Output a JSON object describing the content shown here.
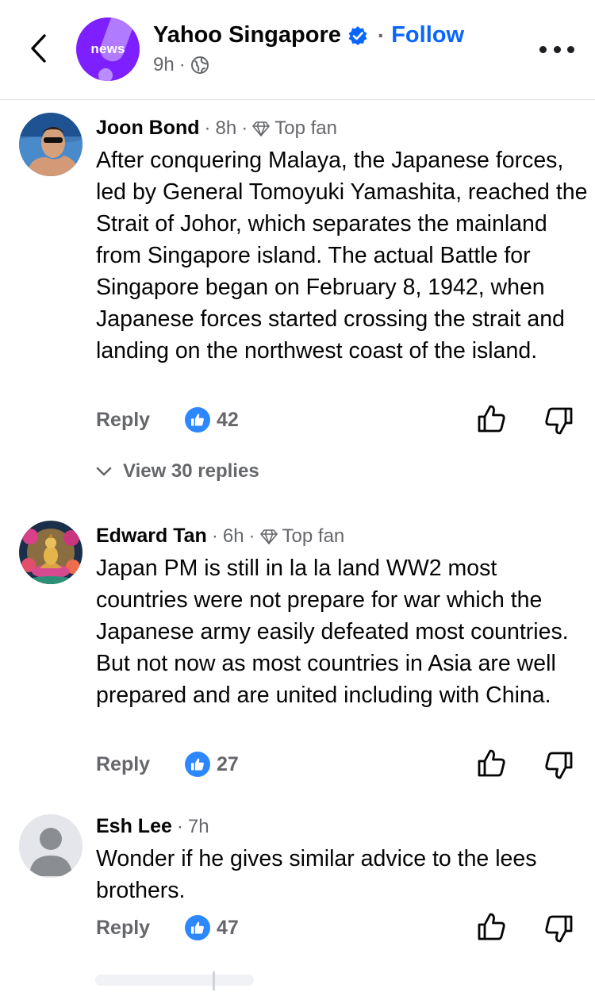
{
  "header": {
    "page_name": "Yahoo Singapore",
    "avatar_label": "news",
    "follow_separator": "·",
    "follow_label": "Follow",
    "time": "9h",
    "meta_separator": "·"
  },
  "comments": [
    {
      "author": "Joon Bond",
      "time": "8h",
      "badge": "Top fan",
      "text": "After conquering Malaya, the Japanese forces, led by General Tomoyuki Yamashita, reached the Strait of Johor, which separates the mainland from Singapore island. The actual Battle for Singapore began on February 8, 1942, when Japanese forces started crossing the strait and landing on the northwest coast of the island.",
      "reply_label": "Reply",
      "likes": "42",
      "view_replies": "View 30 replies"
    },
    {
      "author": "Edward Tan",
      "time": "6h",
      "badge": "Top fan",
      "text": "Japan PM is still in la la land WW2 most countries were not prepare for war which the Japanese army easily defeated most countries. But not now as most countries in Asia are well prepared and are united including with China.",
      "reply_label": "Reply",
      "likes": "27"
    },
    {
      "author": "Esh Lee",
      "time": "7h",
      "text": "Wonder if he gives similar advice to the lees brothers.",
      "reply_label": "Reply",
      "likes": "47"
    }
  ],
  "colors": {
    "accent": "#0866ff",
    "like_badge": "#2d88ff",
    "secondary_text": "#65676b",
    "avatar_brand": "#7e1fff"
  }
}
